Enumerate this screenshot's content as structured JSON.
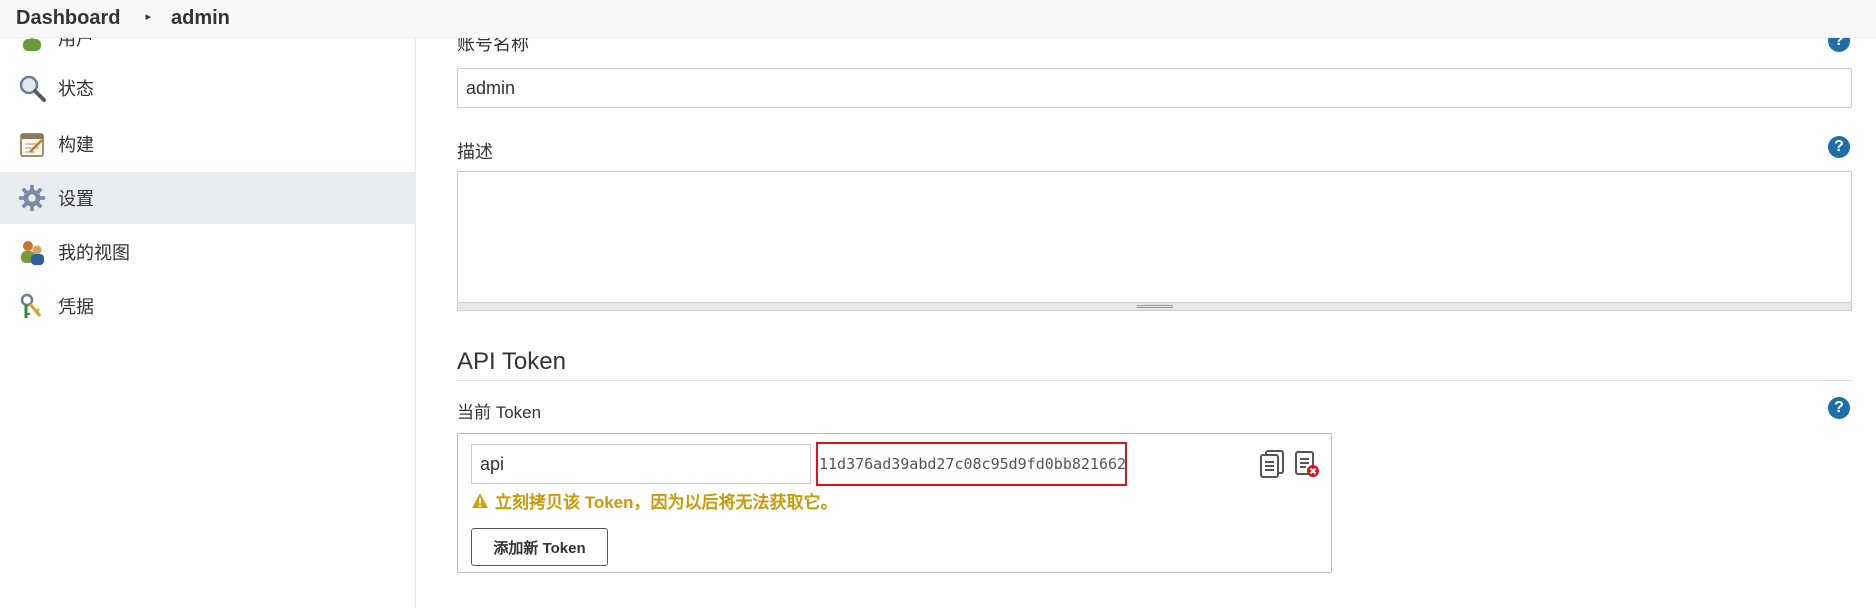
{
  "breadcrumb": {
    "items": [
      {
        "label": "Dashboard"
      },
      {
        "label": "admin"
      }
    ]
  },
  "sidebar": {
    "items": [
      {
        "label": "用户",
        "icon": "user-icon"
      },
      {
        "label": "状态",
        "icon": "magnifier-icon"
      },
      {
        "label": "构建",
        "icon": "notepad-icon"
      },
      {
        "label": "设置",
        "icon": "gear-icon",
        "active": true
      },
      {
        "label": "我的视图",
        "icon": "people-icon"
      },
      {
        "label": "凭据",
        "icon": "keys-icon"
      }
    ]
  },
  "form": {
    "account_label": "账号名称",
    "account_value": "admin",
    "description_label": "描述",
    "description_value": ""
  },
  "api_token": {
    "section_title": "API Token",
    "current_label": "当前 Token",
    "token_name": "api",
    "token_value": "11d376ad39abd27c08c95d9fd0bb821662",
    "warning": "立刻拷贝该 Token，因为以后将无法获取它。",
    "add_button": "添加新 Token"
  },
  "colors": {
    "help": "#1f6ea9",
    "warning": "#c99a0a",
    "token_highlight": "#d9141c",
    "sidebar_active": "#e9edf0"
  }
}
